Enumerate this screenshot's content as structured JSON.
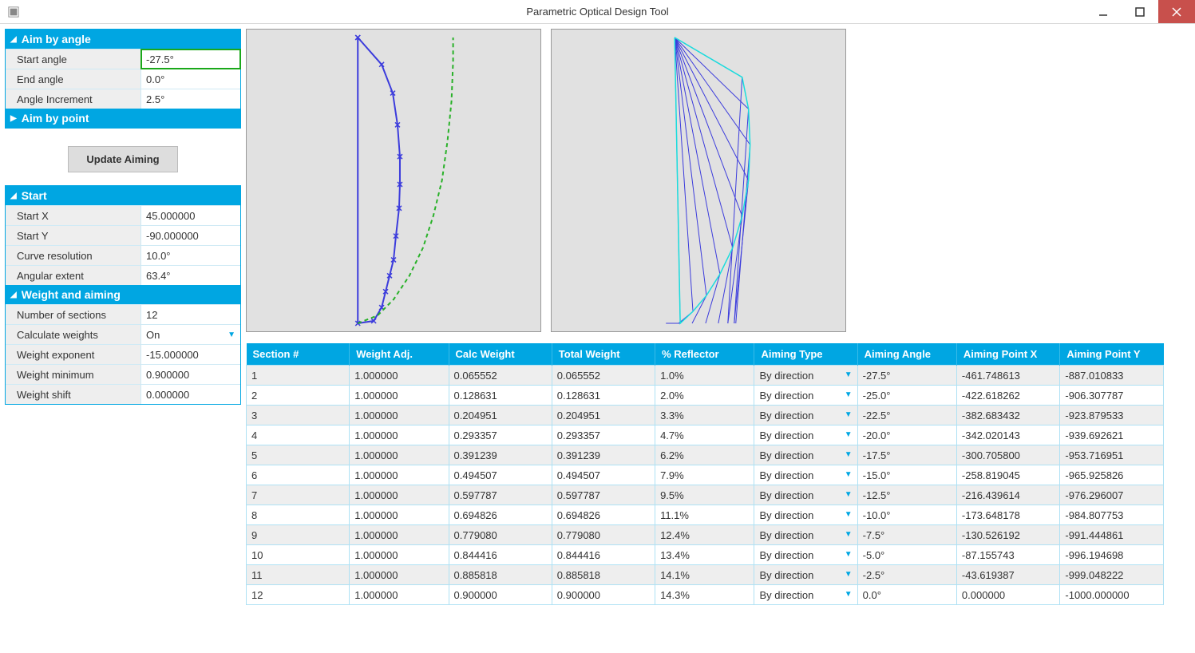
{
  "window": {
    "title": "Parametric Optical Design Tool"
  },
  "aim_by_angle": {
    "header": "Aim by angle",
    "rows": {
      "start_angle": {
        "label": "Start angle",
        "value": "-27.5°"
      },
      "end_angle": {
        "label": "End angle",
        "value": "0.0°"
      },
      "angle_increment": {
        "label": "Angle Increment",
        "value": "2.5°"
      }
    }
  },
  "aim_by_point": {
    "header": "Aim by point"
  },
  "update_btn": "Update Aiming",
  "start_panel": {
    "header": "Start",
    "rows": {
      "start_x": {
        "label": "Start X",
        "value": "45.000000"
      },
      "start_y": {
        "label": "Start Y",
        "value": "-90.000000"
      },
      "curve_res": {
        "label": "Curve resolution",
        "value": "10.0°"
      },
      "angular_extent": {
        "label": "Angular extent",
        "value": "63.4°"
      }
    }
  },
  "weight_panel": {
    "header": "Weight and aiming",
    "rows": {
      "num_sections": {
        "label": "Number of sections",
        "value": "12"
      },
      "calc_weights": {
        "label": "Calculate weights",
        "value": "On"
      },
      "weight_exp": {
        "label": "Weight exponent",
        "value": "-15.000000"
      },
      "weight_min": {
        "label": "Weight minimum",
        "value": "0.900000"
      },
      "weight_shift": {
        "label": "Weight shift",
        "value": "0.000000"
      }
    }
  },
  "table": {
    "headers": {
      "section": "Section #",
      "weight_adj": "Weight Adj.",
      "calc_weight": "Calc Weight",
      "total_weight": "Total Weight",
      "pct_reflector": "% Reflector",
      "aiming_type": "Aiming Type",
      "aiming_angle": "Aiming Angle",
      "aiming_px": "Aiming Point X",
      "aiming_py": "Aiming Point Y"
    },
    "rows": [
      {
        "sec": "1",
        "wa": "1.000000",
        "cw": "0.065552",
        "tw": "0.065552",
        "pr": "1.0%",
        "at": "By direction",
        "aa": "-27.5°",
        "px": "-461.748613",
        "py": "-887.010833"
      },
      {
        "sec": "2",
        "wa": "1.000000",
        "cw": "0.128631",
        "tw": "0.128631",
        "pr": "2.0%",
        "at": "By direction",
        "aa": "-25.0°",
        "px": "-422.618262",
        "py": "-906.307787"
      },
      {
        "sec": "3",
        "wa": "1.000000",
        "cw": "0.204951",
        "tw": "0.204951",
        "pr": "3.3%",
        "at": "By direction",
        "aa": "-22.5°",
        "px": "-382.683432",
        "py": "-923.879533"
      },
      {
        "sec": "4",
        "wa": "1.000000",
        "cw": "0.293357",
        "tw": "0.293357",
        "pr": "4.7%",
        "at": "By direction",
        "aa": "-20.0°",
        "px": "-342.020143",
        "py": "-939.692621"
      },
      {
        "sec": "5",
        "wa": "1.000000",
        "cw": "0.391239",
        "tw": "0.391239",
        "pr": "6.2%",
        "at": "By direction",
        "aa": "-17.5°",
        "px": "-300.705800",
        "py": "-953.716951"
      },
      {
        "sec": "6",
        "wa": "1.000000",
        "cw": "0.494507",
        "tw": "0.494507",
        "pr": "7.9%",
        "at": "By direction",
        "aa": "-15.0°",
        "px": "-258.819045",
        "py": "-965.925826"
      },
      {
        "sec": "7",
        "wa": "1.000000",
        "cw": "0.597787",
        "tw": "0.597787",
        "pr": "9.5%",
        "at": "By direction",
        "aa": "-12.5°",
        "px": "-216.439614",
        "py": "-976.296007"
      },
      {
        "sec": "8",
        "wa": "1.000000",
        "cw": "0.694826",
        "tw": "0.694826",
        "pr": "11.1%",
        "at": "By direction",
        "aa": "-10.0°",
        "px": "-173.648178",
        "py": "-984.807753"
      },
      {
        "sec": "9",
        "wa": "1.000000",
        "cw": "0.779080",
        "tw": "0.779080",
        "pr": "12.4%",
        "at": "By direction",
        "aa": "-7.5°",
        "px": "-130.526192",
        "py": "-991.444861"
      },
      {
        "sec": "10",
        "wa": "1.000000",
        "cw": "0.844416",
        "tw": "0.844416",
        "pr": "13.4%",
        "at": "By direction",
        "aa": "-5.0°",
        "px": "-87.155743",
        "py": "-996.194698"
      },
      {
        "sec": "11",
        "wa": "1.000000",
        "cw": "0.885818",
        "tw": "0.885818",
        "pr": "14.1%",
        "at": "By direction",
        "aa": "-2.5°",
        "px": "-43.619387",
        "py": "-999.048222"
      },
      {
        "sec": "12",
        "wa": "1.000000",
        "cw": "0.900000",
        "tw": "0.900000",
        "pr": "14.3%",
        "at": "By direction",
        "aa": "0.0°",
        "px": "0.000000",
        "py": "-1000.000000"
      }
    ]
  },
  "chart_data": [
    {
      "type": "line",
      "title": "",
      "series": [
        {
          "name": "reflector-profile",
          "color": "#3b3bdc",
          "points": [
            [
              140,
              10
            ],
            [
              140,
              370
            ],
            [
              160,
              367
            ],
            [
              170,
              350
            ],
            [
              175,
              330
            ],
            [
              180,
              310
            ],
            [
              185,
              290
            ],
            [
              188,
              260
            ],
            [
              192,
              225
            ],
            [
              193,
              195
            ],
            [
              193,
              160
            ],
            [
              190,
              120
            ],
            [
              184,
              80
            ],
            [
              170,
              44
            ],
            [
              140,
              10
            ]
          ],
          "markers": true
        },
        {
          "name": "aux-curve",
          "color": "#28b128",
          "dash": true,
          "points": [
            [
              140,
              370
            ],
            [
              165,
              360
            ],
            [
              185,
              340
            ],
            [
              205,
              310
            ],
            [
              222,
              275
            ],
            [
              235,
              235
            ],
            [
              246,
              190
            ],
            [
              253,
              140
            ],
            [
              258,
              90
            ],
            [
              260,
              40
            ],
            [
              260,
              10
            ]
          ]
        }
      ]
    },
    {
      "type": "line",
      "title": "",
      "series": [
        {
          "name": "ray-trace-outline",
          "color": "#1adddd",
          "points": [
            [
              155,
              10
            ],
            [
              240,
              60
            ],
            [
              248,
              100
            ],
            [
              250,
              145
            ],
            [
              248,
              190
            ],
            [
              240,
              235
            ],
            [
              228,
              275
            ],
            [
              212,
              308
            ],
            [
              195,
              335
            ],
            [
              178,
              355
            ],
            [
              162,
              370
            ],
            [
              155,
              10
            ]
          ]
        }
      ],
      "rays": {
        "origin": [
          155,
          10
        ],
        "targets": [
          [
            240,
            60
          ],
          [
            248,
            100
          ],
          [
            250,
            145
          ],
          [
            248,
            190
          ],
          [
            240,
            235
          ],
          [
            228,
            275
          ],
          [
            212,
            308
          ],
          [
            195,
            335
          ],
          [
            178,
            355
          ],
          [
            162,
            370
          ]
        ],
        "reflect_to_y": 370,
        "color": "#3b3bdc"
      }
    }
  ]
}
